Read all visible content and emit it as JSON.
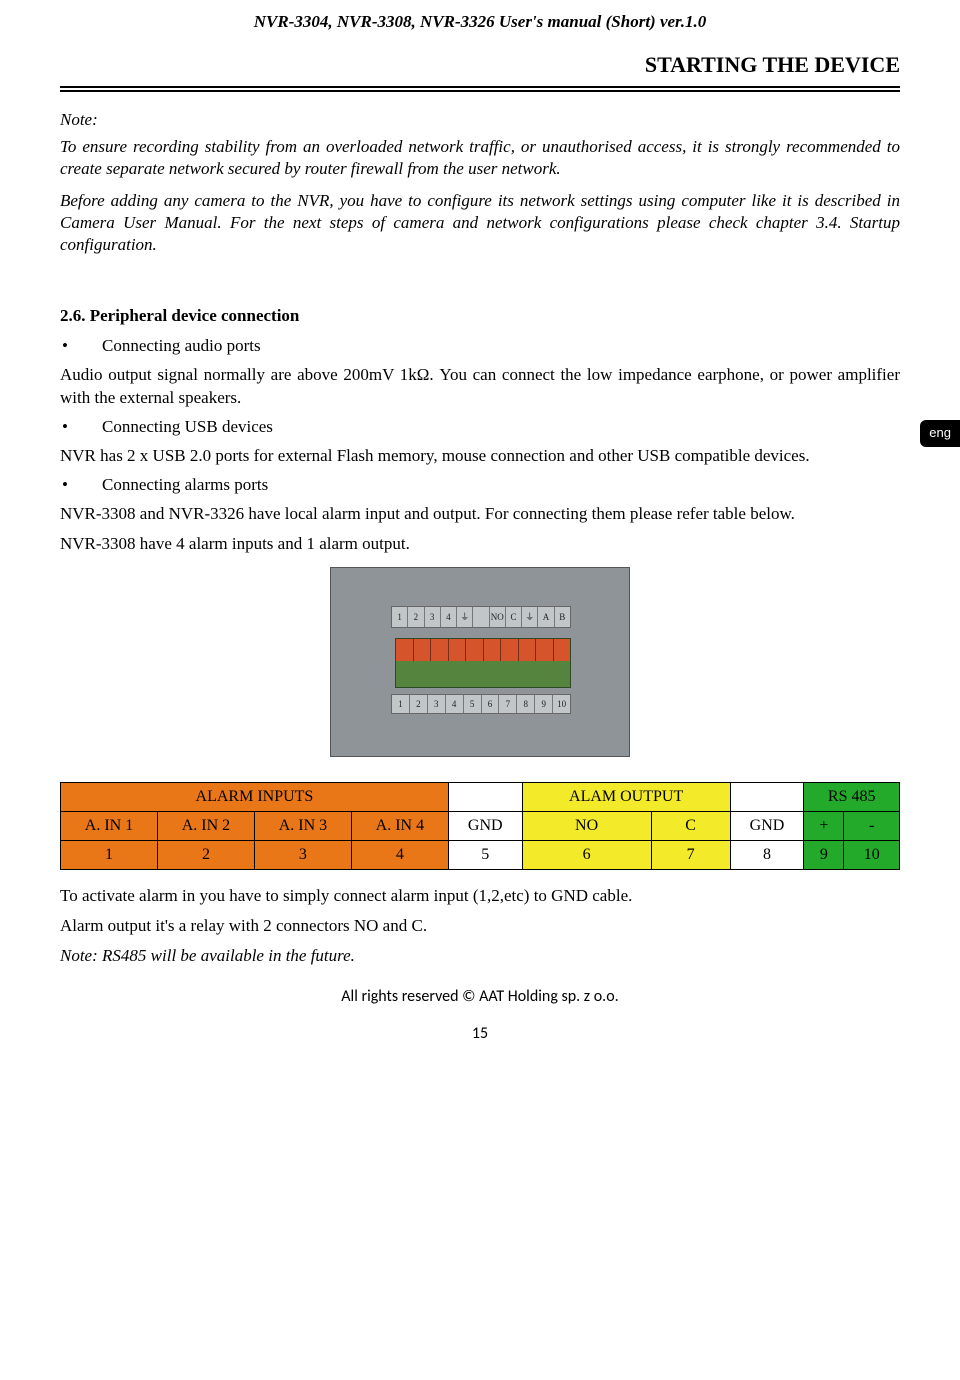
{
  "header": "NVR-3304, NVR-3308, NVR-3326  User's manual (Short)  ver.1.0",
  "chapter": "STARTING THE DEVICE",
  "note": {
    "label": "Note:",
    "p1": "To ensure recording stability from an overloaded network traffic, or unauthorised access, it is strongly recommended to create separate network secured by router firewall from the user network.",
    "p2": "Before adding any camera to the NVR, you have to configure its network settings using computer like it is described in Camera User Manual. For the next steps of camera and network configurations please check chapter 3.4. Startup configuration."
  },
  "lang_tab": "eng",
  "section": {
    "title": "2.6.   Peripheral device connection",
    "bul_audio": "Connecting audio ports",
    "p_audio": "Audio output signal normally are above 200mV 1kΩ. You can connect the low impedance earphone, or  power amplifier with the external speakers.",
    "bul_usb": "Connecting USB devices",
    "p_usb": "NVR has 2 x USB 2.0 ports for external Flash memory, mouse connection and other USB compatible devices.",
    "bul_alarm": "Connecting alarms ports",
    "p_alarm1": "NVR-3308 and NVR-3326 have local alarm input and output. For connecting them please refer table below.",
    "p_alarm2": "NVR-3308 have 4 alarm inputs and 1 alarm output."
  },
  "hw": {
    "top": [
      "1",
      "2",
      "3",
      "4",
      "⏚",
      "",
      "NO",
      "C",
      "⏚",
      "A",
      "B"
    ],
    "bot": [
      "1",
      "2",
      "3",
      "4",
      "5",
      "6",
      "7",
      "8",
      "9",
      "10"
    ]
  },
  "table": {
    "h1": "ALARM INPUTS",
    "h2": "",
    "h3": "ALAM OUTPUT",
    "h4": "",
    "h5": "RS 485",
    "r2": [
      "A. IN 1",
      "A. IN 2",
      "A. IN 3",
      "A. IN 4",
      "GND",
      "NO",
      "C",
      "GND",
      "+",
      "-"
    ],
    "r3": [
      "1",
      "2",
      "3",
      "4",
      "5",
      "6",
      "7",
      "8",
      "9",
      "10"
    ]
  },
  "tail": {
    "p1": "To activate alarm in you have to simply connect alarm input (1,2,etc) to GND cable.",
    "p2": "Alarm output it's a relay with 2 connectors NO and C.",
    "p3": "Note: RS485 will be available in the future."
  },
  "footer": "All rights reserved © AAT Holding sp. z o.o.",
  "pagenum": "15"
}
